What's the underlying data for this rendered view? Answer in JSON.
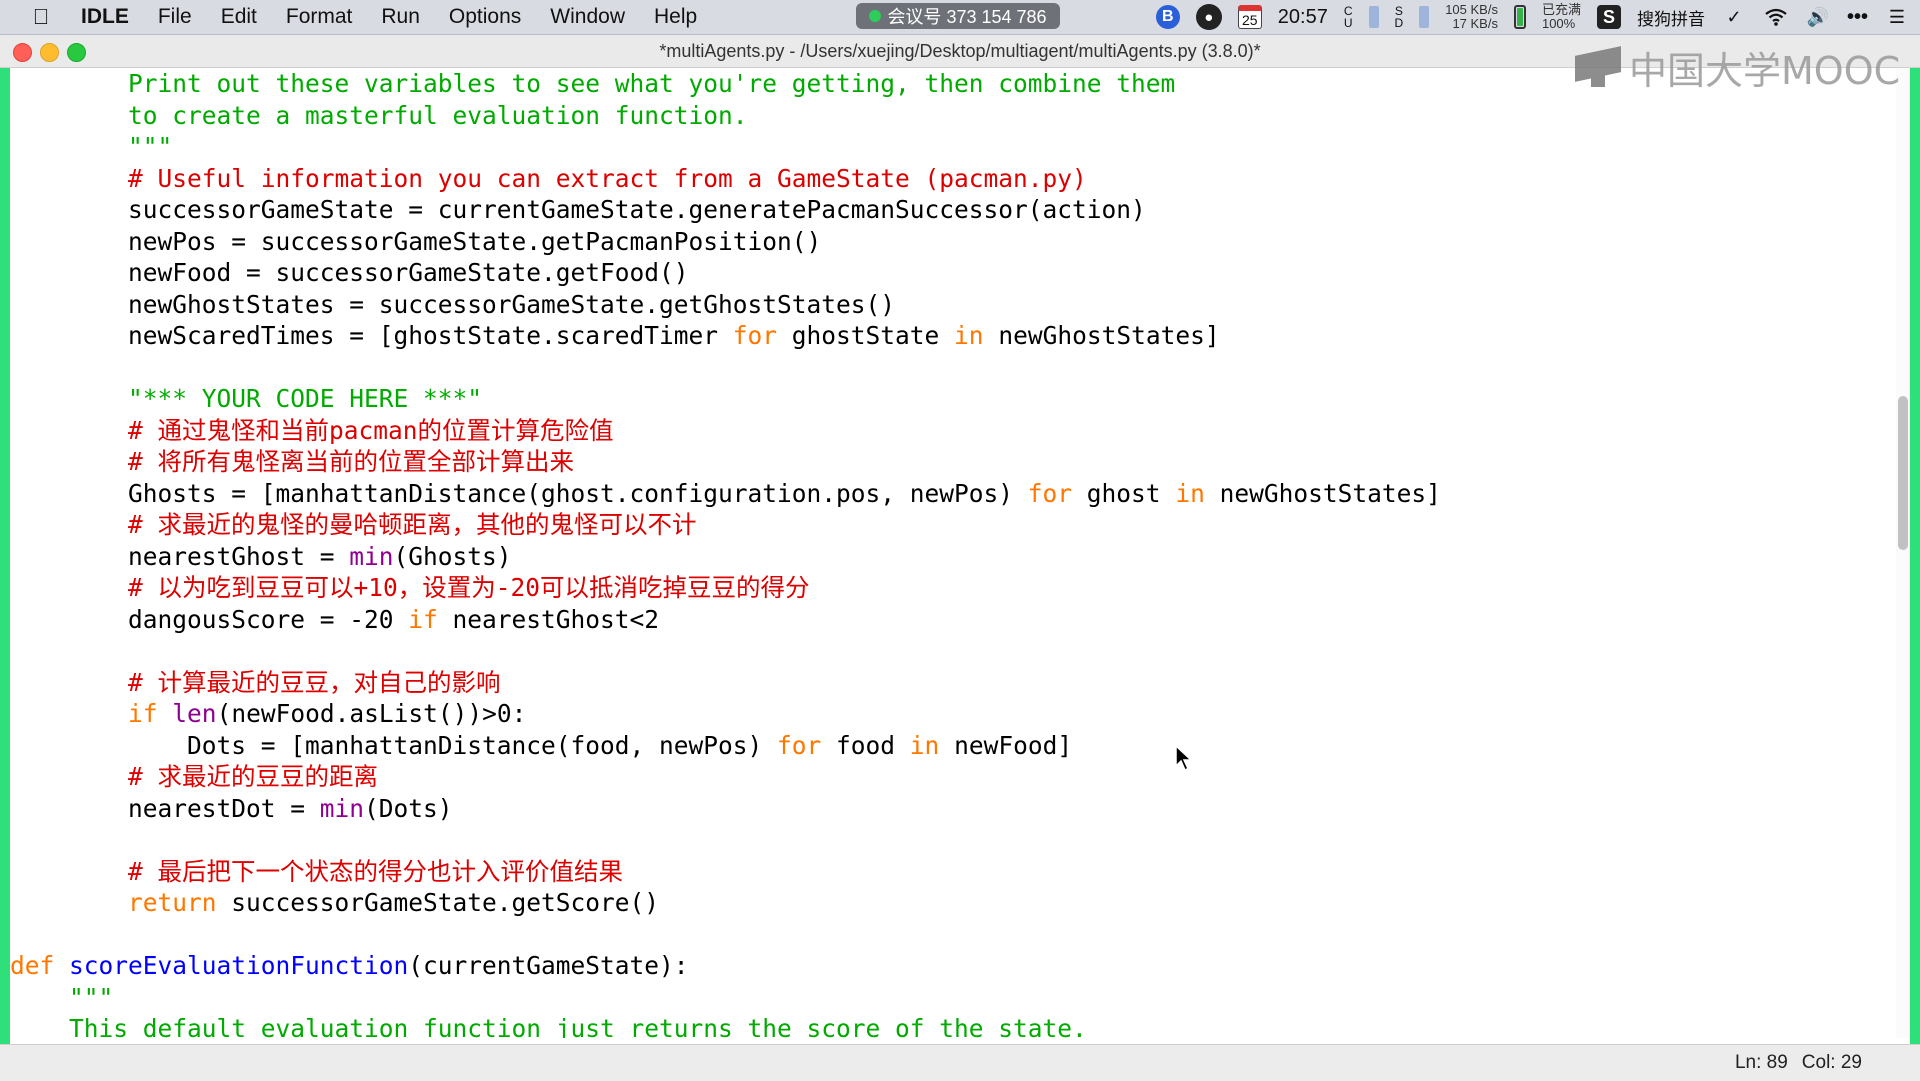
{
  "menubar": {
    "app_name": "IDLE",
    "items": [
      "File",
      "Edit",
      "Format",
      "Run",
      "Options",
      "Window",
      "Help"
    ],
    "meeting_label": "会议号 373 154 786",
    "calendar_day": "25",
    "time": "20:57",
    "net_up": "105 KB/s",
    "net_down": "17 KB/s",
    "battery_status": "已充满",
    "battery_percent": "100%",
    "input_method": "搜狗拼音",
    "more_label": "•••"
  },
  "window": {
    "title": "*multiAgents.py - /Users/xuejing/Desktop/multiagent/multiAgents.py (3.8.0)*"
  },
  "watermark": {
    "text": "中国大学MOOC"
  },
  "code_lines": [
    [
      {
        "t": "        "
      },
      {
        "t": "Print out these variables to see what you're getting, then combine them",
        "c": "str"
      }
    ],
    [
      {
        "t": "        "
      },
      {
        "t": "to create a masterful evaluation function.",
        "c": "str"
      }
    ],
    [
      {
        "t": "        "
      },
      {
        "t": "\"\"\"",
        "c": "str"
      }
    ],
    [
      {
        "t": "        "
      },
      {
        "t": "# Useful information you can extract from a GameState (pacman.py)",
        "c": "com"
      }
    ],
    [
      {
        "t": "        successorGameState = currentGameState.generatePacmanSuccessor(action)"
      }
    ],
    [
      {
        "t": "        newPos = successorGameState.getPacmanPosition()"
      }
    ],
    [
      {
        "t": "        newFood = successorGameState.getFood()"
      }
    ],
    [
      {
        "t": "        newGhostStates = successorGameState.getGhostStates()"
      }
    ],
    [
      {
        "t": "        newScaredTimes = [ghostState.scaredTimer "
      },
      {
        "t": "for",
        "c": "kw"
      },
      {
        "t": " ghostState "
      },
      {
        "t": "in",
        "c": "kw"
      },
      {
        "t": " newGhostStates]"
      }
    ],
    [
      {
        "t": ""
      }
    ],
    [
      {
        "t": "        "
      },
      {
        "t": "\"*** YOUR CODE HERE ***\"",
        "c": "str"
      }
    ],
    [
      {
        "t": "        "
      },
      {
        "t": "# 通过鬼怪和当前pacman的位置计算危险值",
        "c": "com"
      }
    ],
    [
      {
        "t": "        "
      },
      {
        "t": "# 将所有鬼怪离当前的位置全部计算出来",
        "c": "com"
      }
    ],
    [
      {
        "t": "        Ghosts = [manhattanDistance(ghost.configuration.pos, newPos) "
      },
      {
        "t": "for",
        "c": "kw"
      },
      {
        "t": " ghost "
      },
      {
        "t": "in",
        "c": "kw"
      },
      {
        "t": " newGhostStates]"
      }
    ],
    [
      {
        "t": "        "
      },
      {
        "t": "# 求最近的鬼怪的曼哈顿距离，其他的鬼怪可以不计",
        "c": "com"
      }
    ],
    [
      {
        "t": "        nearestGhost = "
      },
      {
        "t": "min",
        "c": "bi"
      },
      {
        "t": "(Ghosts)"
      }
    ],
    [
      {
        "t": "        "
      },
      {
        "t": "# 以为吃到豆豆可以+10，设置为-20可以抵消吃掉豆豆的得分",
        "c": "com"
      }
    ],
    [
      {
        "t": "        dangousScore = -20 "
      },
      {
        "t": "if",
        "c": "kw"
      },
      {
        "t": " nearestGhost<2"
      }
    ],
    [
      {
        "t": ""
      }
    ],
    [
      {
        "t": "        "
      },
      {
        "t": "# 计算最近的豆豆，对自己的影响",
        "c": "com"
      }
    ],
    [
      {
        "t": "        "
      },
      {
        "t": "if",
        "c": "kw"
      },
      {
        "t": " "
      },
      {
        "t": "len",
        "c": "bi"
      },
      {
        "t": "(newFood.asList())>0:"
      }
    ],
    [
      {
        "t": "            Dots = [manhattanDistance(food, newPos) "
      },
      {
        "t": "for",
        "c": "kw"
      },
      {
        "t": " food "
      },
      {
        "t": "in",
        "c": "kw"
      },
      {
        "t": " newFood]"
      }
    ],
    [
      {
        "t": "        "
      },
      {
        "t": "# 求最近的豆豆的距离",
        "c": "com"
      }
    ],
    [
      {
        "t": "        nearestDot = "
      },
      {
        "t": "min",
        "c": "bi"
      },
      {
        "t": "(Dots)"
      }
    ],
    [
      {
        "t": ""
      }
    ],
    [
      {
        "t": "        "
      },
      {
        "t": "# 最后把下一个状态的得分也计入评价值结果",
        "c": "com"
      }
    ],
    [
      {
        "t": "        "
      },
      {
        "t": "return",
        "c": "kw"
      },
      {
        "t": " successorGameState.getScore()"
      }
    ],
    [
      {
        "t": ""
      }
    ],
    [
      {
        "t": "def",
        "c": "kw"
      },
      {
        "t": " "
      },
      {
        "t": "scoreEvaluationFunction",
        "c": "def"
      },
      {
        "t": "(currentGameState):"
      }
    ],
    [
      {
        "t": "    "
      },
      {
        "t": "\"\"\"",
        "c": "str"
      }
    ],
    [
      {
        "t": "    "
      },
      {
        "t": "This default evaluation function just returns the score of the state.",
        "c": "str"
      }
    ]
  ],
  "statusbar": {
    "line": "Ln: 89",
    "col": "Col: 29"
  }
}
